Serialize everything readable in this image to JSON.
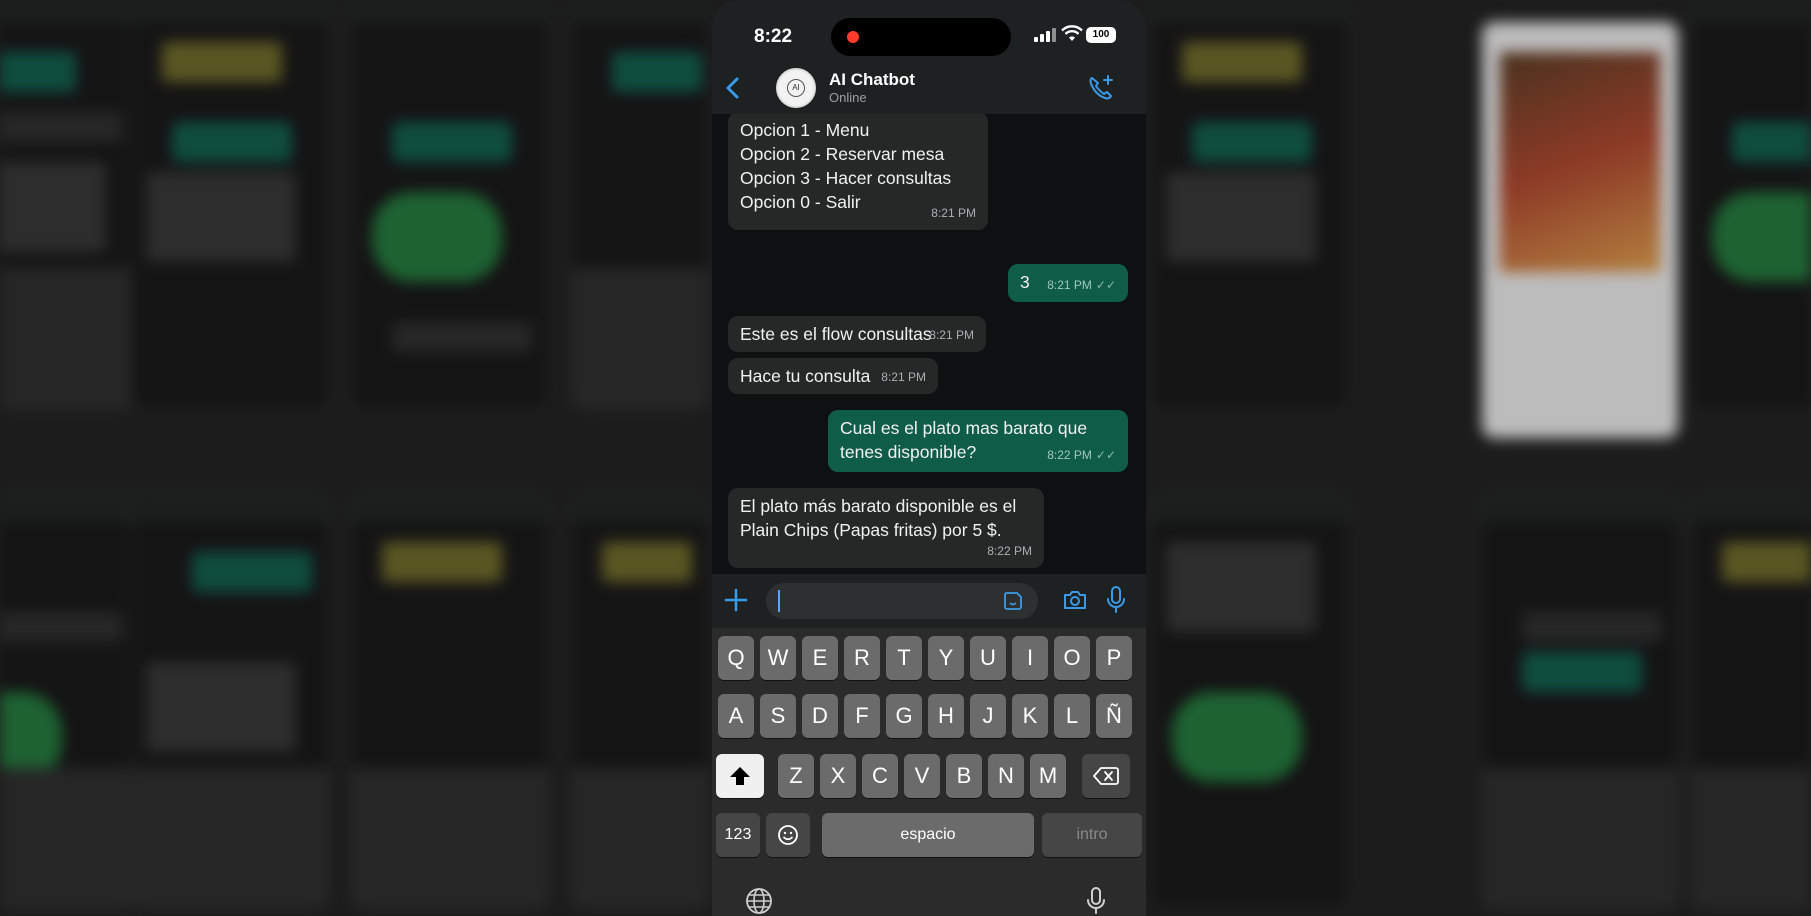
{
  "status_bar": {
    "time": "8:22",
    "battery": "100"
  },
  "header": {
    "contact_name": "AI Chatbot",
    "contact_status": "Online",
    "avatar_text": "AI"
  },
  "messages": [
    {
      "dir": "in",
      "lines": [
        "Opcion 1 - Menu",
        "Opcion 2 - Reservar mesa",
        "Opcion 3 - Hacer consultas",
        "",
        "Opcion 0 - Salir"
      ],
      "time": "8:21 PM"
    },
    {
      "dir": "out",
      "lines": [
        "3"
      ],
      "time": "8:21 PM"
    },
    {
      "dir": "in",
      "lines": [
        "Este es el flow consultas"
      ],
      "time": "8:21 PM"
    },
    {
      "dir": "in",
      "lines": [
        "Hace tu consulta"
      ],
      "time": "8:21 PM"
    },
    {
      "dir": "out",
      "lines": [
        "Cual es el plato mas barato que",
        "tenes disponible?"
      ],
      "time": "8:22 PM"
    },
    {
      "dir": "in",
      "lines": [
        "El plato más barato disponible es el",
        "Plain Chips (Papas fritas) por 5 $."
      ],
      "time": "8:22 PM"
    }
  ],
  "compose": {
    "value": ""
  },
  "keyboard": {
    "row1": [
      "Q",
      "W",
      "E",
      "R",
      "T",
      "Y",
      "U",
      "I",
      "O",
      "P"
    ],
    "row2": [
      "A",
      "S",
      "D",
      "F",
      "G",
      "H",
      "J",
      "K",
      "L",
      "Ñ"
    ],
    "row3": [
      "Z",
      "X",
      "C",
      "V",
      "B",
      "N",
      "M"
    ],
    "numbers_label": "123",
    "space_label": "espacio",
    "return_label": "intro"
  },
  "colors": {
    "incoming": "#262828",
    "outgoing": "#0f5c48",
    "header": "#1e2121",
    "accent": "#58a6ff"
  },
  "icons": [
    "back-icon",
    "call-add-icon",
    "plus-icon",
    "sticker-icon",
    "camera-icon",
    "mic-icon",
    "shift-icon",
    "backspace-icon",
    "emoji-icon",
    "globe-icon"
  ]
}
